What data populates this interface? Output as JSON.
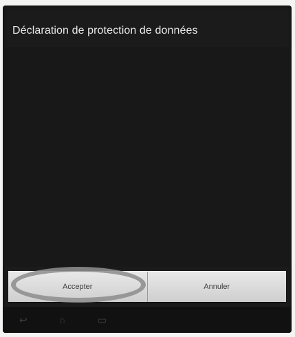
{
  "dialog": {
    "title": "Déclaration de protection de données"
  },
  "buttons": {
    "accept_label": "Accepter",
    "cancel_label": "Annuler"
  },
  "nav": {
    "icons": [
      "back-icon",
      "home-icon",
      "recent-apps-icon"
    ]
  },
  "colors": {
    "dialog_background": "#1b1b1b",
    "button_bar_background": "#d7d7d7",
    "highlight_ring": "#8e8e8e"
  }
}
